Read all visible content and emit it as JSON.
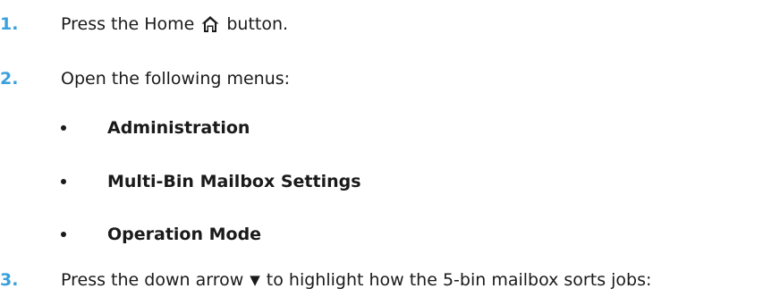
{
  "steps": [
    {
      "number": "1.",
      "text_before": "Press the Home",
      "icon": "home-icon",
      "text_after": "button."
    },
    {
      "number": "2.",
      "text": "Open the following menus:"
    },
    {
      "number": "3.",
      "text_before": "Press the down arrow",
      "icon": "down-arrow-icon",
      "icon_glyph": "▼",
      "text_after": "to highlight how the 5-bin mailbox sorts jobs:"
    }
  ],
  "menus": [
    "Administration",
    "Multi-Bin Mailbox Settings",
    "Operation Mode"
  ],
  "colors": {
    "step_number": "#3aa0dc",
    "text": "#1a1a1a"
  }
}
